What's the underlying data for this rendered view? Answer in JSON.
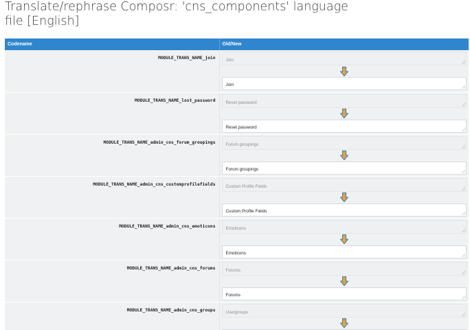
{
  "page": {
    "title": "Translate/rephrase Composr: 'cns_components' language file [English]"
  },
  "table": {
    "headers": {
      "codename": "Codename",
      "old_new": "Old/New"
    },
    "rows": [
      {
        "codename": "MODULE_TRANS_NAME_join",
        "old": "Join",
        "new": "Join"
      },
      {
        "codename": "MODULE_TRANS_NAME_lost_password",
        "old": "Reset password",
        "new": "Reset password"
      },
      {
        "codename": "MODULE_TRANS_NAME_admin_cns_forum_groupings",
        "old": "Forum groupings",
        "new": "Forum groupings"
      },
      {
        "codename": "MODULE_TRANS_NAME_admin_cns_customprofilefields",
        "old": "Custom Profile Fields",
        "new": "Custom Profile Fields"
      },
      {
        "codename": "MODULE_TRANS_NAME_admin_cns_emoticons",
        "old": "Emoticons",
        "new": "Emoticons"
      },
      {
        "codename": "MODULE_TRANS_NAME_admin_cns_forums",
        "old": "Forums",
        "new": "Forums"
      },
      {
        "codename": "MODULE_TRANS_NAME_admin_cns_groups",
        "old": "Usergroups",
        "new": ""
      }
    ]
  },
  "icons": {
    "arrow": "down-arrow-icon",
    "resize": "resize-grip-icon"
  },
  "colors": {
    "header": "#2f86cf",
    "arrow_fill": "#f0a030",
    "arrow_stroke": "#2b7fc4"
  }
}
